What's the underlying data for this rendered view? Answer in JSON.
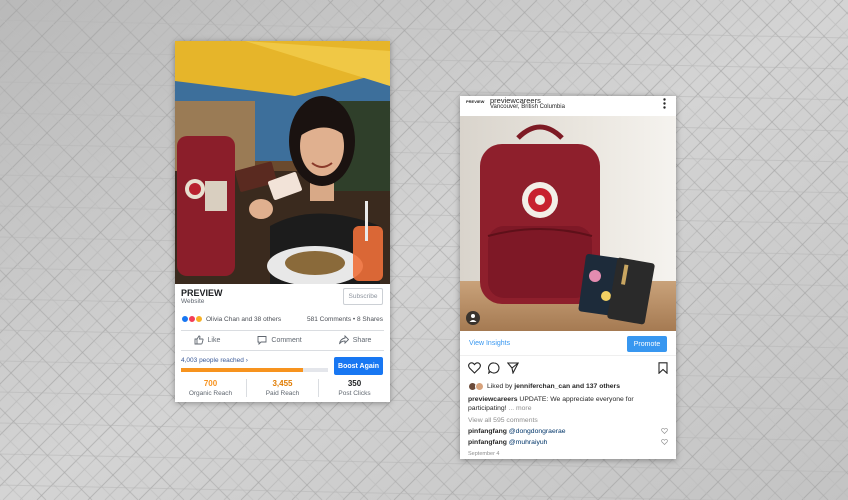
{
  "colors": {
    "background": "#c8c8c8",
    "facebook_blue": "#1877f2",
    "progress_orange": "#f7931e",
    "instagram_blue": "#3897f0"
  },
  "facebook_post": {
    "page_name": "PREVIEW",
    "page_type": "Website",
    "subscribe_label": "Subscribe",
    "reactions_text": "Olivia Chan and 38 others",
    "comments_shares": "581 Comments • 8 Shares",
    "actions": [
      {
        "label": "Like",
        "icon": "thumbs-up-icon"
      },
      {
        "label": "Comment",
        "icon": "comment-icon"
      },
      {
        "label": "Share",
        "icon": "share-icon"
      }
    ],
    "reach_text": "4,003 people reached",
    "reach_progress_fraction": 0.83,
    "boost_label": "Boost Again",
    "metrics": [
      {
        "value": "700",
        "label": "Organic Reach",
        "color": "#f7931e"
      },
      {
        "value": "3,455",
        "label": "Paid Reach",
        "color": "#e07b00"
      },
      {
        "value": "350",
        "label": "Post Clicks",
        "color": "#1c1e21"
      }
    ]
  },
  "instagram_post": {
    "logo_text": "PREVIEW",
    "username": "previewcareers",
    "location": "Vancouver, British Columbia",
    "view_insights": "View Insights",
    "promote_label": "Promote",
    "likes_prefix": "Liked by ",
    "likes_user": "jenniferchan_can",
    "likes_suffix": " and 137 others",
    "caption_user": "previewcareers",
    "caption_text": " UPDATE: We appreciate everyone for participating!",
    "caption_more": " ... more",
    "view_comments": "View all 595 comments",
    "comments": [
      {
        "user": "pinfangfang",
        "mention": "@dongdongraerae"
      },
      {
        "user": "pinfangfang",
        "mention": "@muhraiyuh"
      }
    ],
    "date": "September 4"
  }
}
